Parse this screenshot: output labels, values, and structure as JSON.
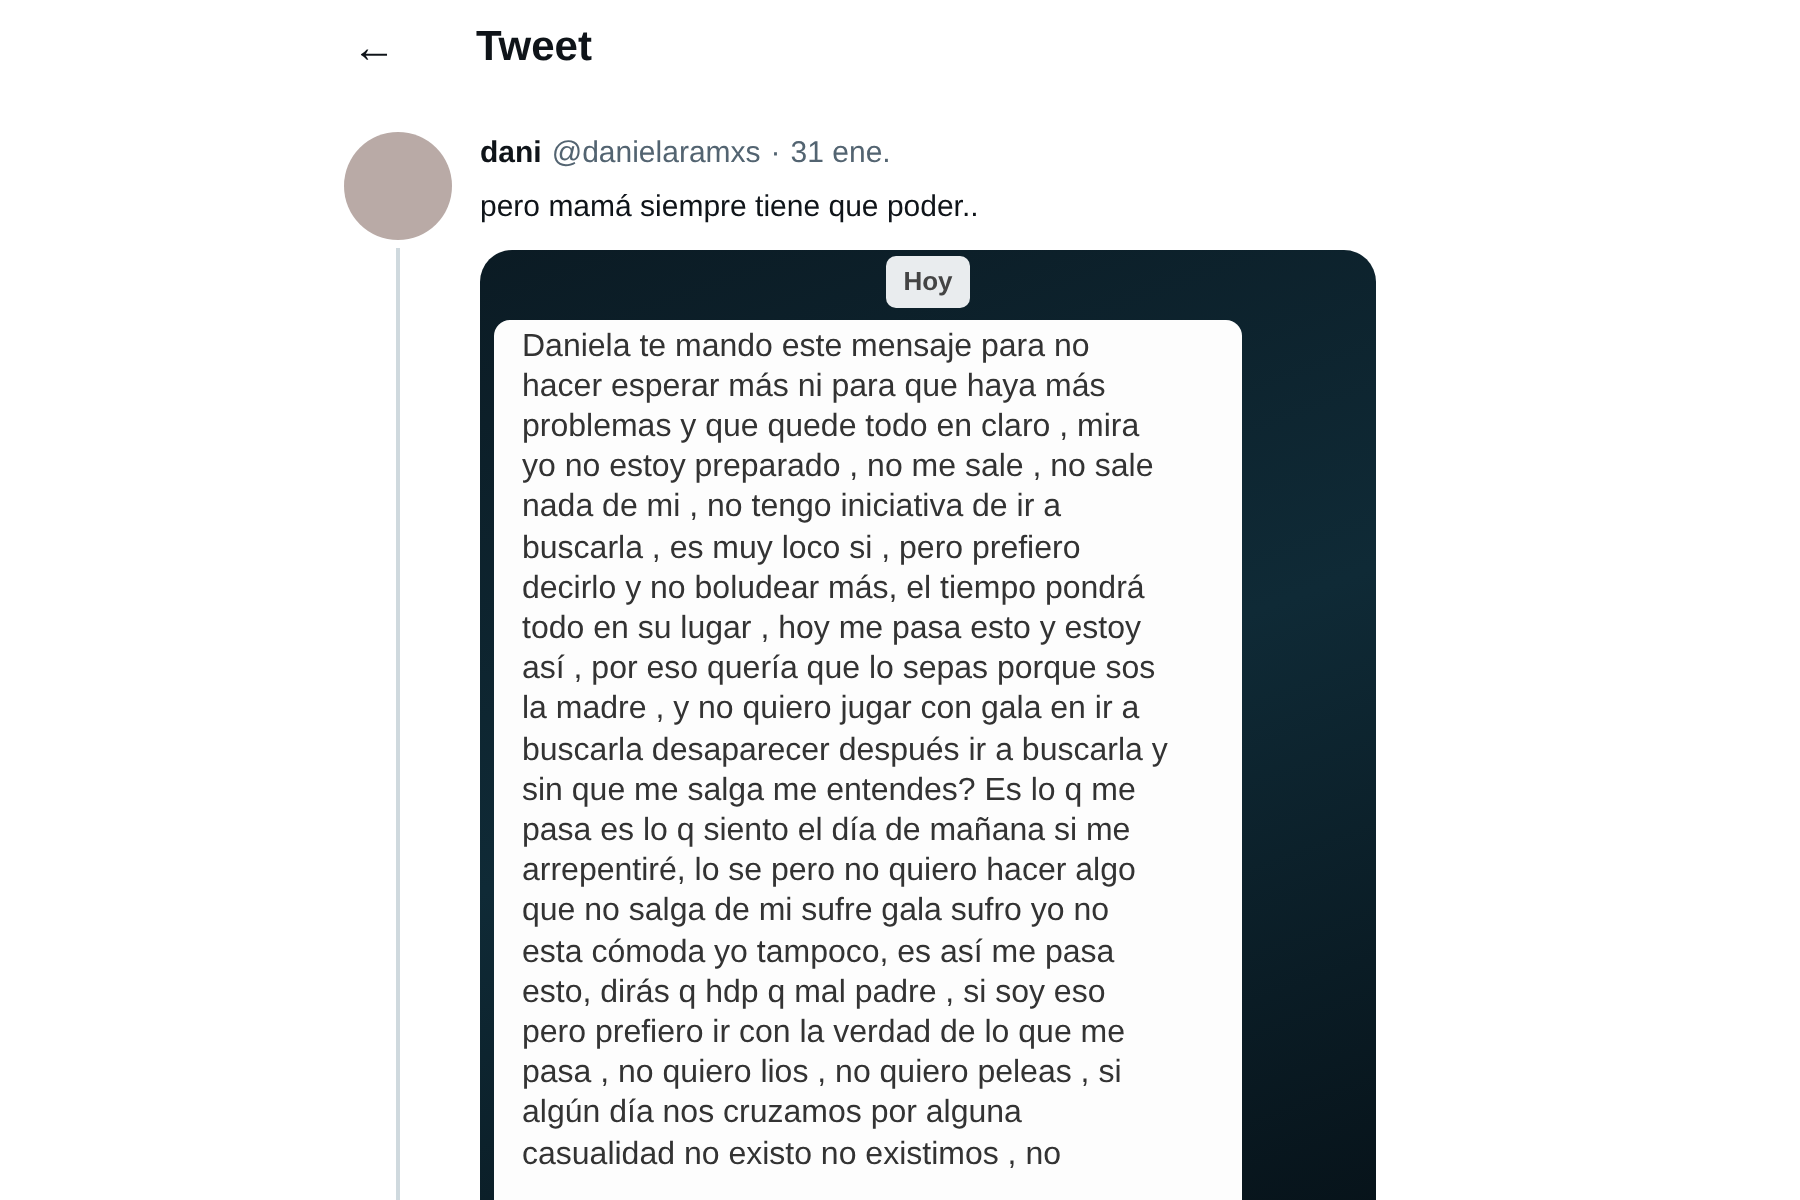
{
  "header": {
    "back": "←",
    "title": "Tweet"
  },
  "tweet": {
    "name": "dani",
    "handle": "@danielaramxs",
    "separator": "·",
    "date": "31 ene.",
    "text": "pero mamá siempre tiene que poder..",
    "image": {
      "date_chip": "Hoy",
      "message_lines": [
        "Daniela te mando este mensaje para no",
        "hacer esperar más ni para que haya más",
        "problemas y que quede todo en claro , mira",
        "yo no estoy preparado , no me sale , no sale",
        "nada de mi , no tengo iniciativa de ir a",
        "buscarla , es muy loco si , pero prefiero",
        "decirlo y no boludear más,  el tiempo pondrá",
        "todo en su lugar , hoy me pasa esto y estoy",
        "así , por eso quería que lo sepas porque sos",
        "la madre , y no quiero jugar con gala en ir a",
        "buscarla desaparecer después ir a buscarla y",
        "sin que me salga me entendes? Es lo q me",
        "pasa es lo q siento el día de mañana si me",
        "arrepentiré,  lo se pero no quiero hacer algo",
        "que no salga de mi sufre gala sufro yo no",
        "esta cómoda yo tampoco, es así me pasa",
        "esto, dirás q hdp q mal padre , si soy eso",
        "pero prefiero ir con la verdad de lo que me",
        "pasa , no quiero lios , no quiero peleas , si",
        "algún día nos cruzamos por alguna",
        "casualidad no existo no existimos , no"
      ]
    }
  }
}
